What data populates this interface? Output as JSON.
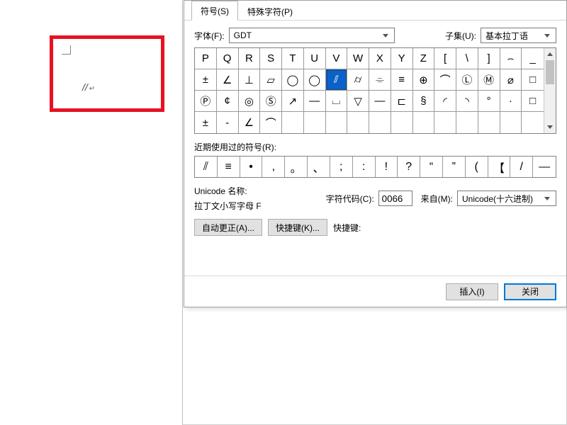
{
  "doc": {
    "sample_text": "//",
    "return_glyph": "↵"
  },
  "tabs": {
    "symbols": "符号(S)",
    "special": "特殊字符(P)"
  },
  "font": {
    "label": "字体(F):",
    "value": "GDT"
  },
  "subset": {
    "label": "子集(U):",
    "value": "基本拉丁语"
  },
  "grid": {
    "rows": [
      [
        "P",
        "Q",
        "R",
        "S",
        "T",
        "U",
        "V",
        "W",
        "X",
        "Y",
        "Z",
        "[",
        "\\",
        "]",
        "⌢",
        "_"
      ],
      [
        "±",
        "∠",
        "⊥",
        "▱",
        "◯",
        "◯",
        "⫽",
        "⌭",
        "⌯",
        "≡",
        "⊕",
        "⌒",
        "Ⓛ",
        "Ⓜ",
        "⌀",
        "□"
      ],
      [
        "Ⓟ",
        "¢",
        "◎",
        "Ⓢ",
        "↗",
        "—",
        "⌴",
        "▽",
        "—",
        "⊏",
        "§",
        "◜",
        "◝",
        "°",
        "·",
        "□"
      ],
      [
        "±",
        "-",
        "∠",
        "⌒",
        "",
        "",
        "",
        "",
        "",
        "",
        "",
        "",
        "",
        "",
        "",
        ""
      ]
    ],
    "selected": {
      "row": 1,
      "col": 6
    }
  },
  "recent": {
    "label": "近期使用过的符号(R):",
    "items": [
      "⫽",
      "≡",
      "•",
      ",",
      "。",
      "、",
      ";",
      ":",
      "!",
      "?",
      "“",
      "”",
      "(",
      "【",
      "/",
      "—"
    ]
  },
  "unicode": {
    "name_label": "Unicode 名称:",
    "name_value": "拉丁文小写字母 F",
    "code_label": "字符代码(C):",
    "code_value": "0066",
    "from_label": "来自(M):",
    "from_value": "Unicode(十六进制)"
  },
  "buttons": {
    "autocorrect": "自动更正(A)...",
    "shortcut": "快捷键(K)...",
    "shortcut_label": "快捷键:",
    "insert": "插入(I)",
    "close": "关闭"
  }
}
